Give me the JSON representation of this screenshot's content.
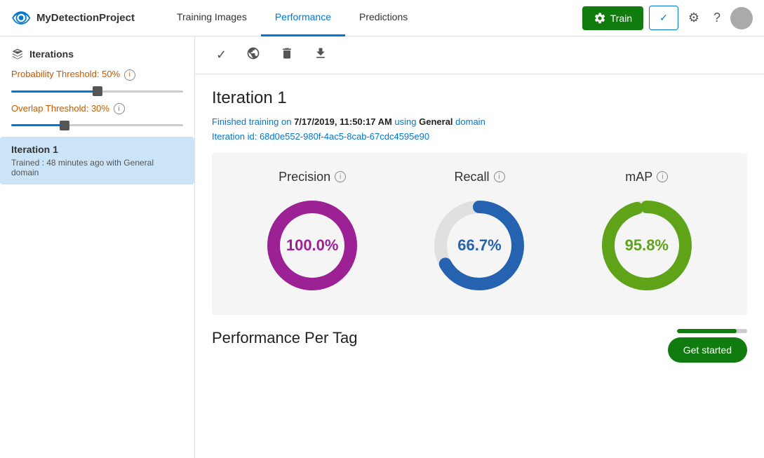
{
  "app": {
    "title": "MyDetectionProject",
    "logo_icon": "👁"
  },
  "nav": {
    "tabs": [
      {
        "id": "training-images",
        "label": "Training Images",
        "active": false
      },
      {
        "id": "performance",
        "label": "Performance",
        "active": true
      },
      {
        "id": "predictions",
        "label": "Predictions",
        "active": false
      }
    ]
  },
  "header_actions": {
    "train_label": "Train",
    "check_icon": "✓",
    "settings_icon": "⚙",
    "help_icon": "?"
  },
  "sidebar": {
    "title": "Iterations",
    "probability_threshold_label": "Probability Threshold:",
    "probability_threshold_value": "50%",
    "overlap_threshold_label": "Overlap Threshold:",
    "overlap_threshold_value": "30%",
    "iterations": [
      {
        "id": "iteration-1",
        "title": "Iteration 1",
        "description": "Trained : 48 minutes ago with General domain",
        "active": true
      }
    ]
  },
  "toolbar": {
    "check_title": "Set as Default",
    "globe_title": "Publish",
    "delete_title": "Delete",
    "download_title": "Export"
  },
  "iteration_detail": {
    "title": "Iteration 1",
    "training_date": "7/17/2019, 11:50:17 AM",
    "domain": "General",
    "iteration_id": "68d0e552-980f-4ac5-8cab-67cdc4595e90",
    "meta_line1_prefix": "Finished training on ",
    "meta_line1_suffix": " using ",
    "meta_line1_suffix2": " domain",
    "meta_line2_prefix": "Iteration id: "
  },
  "metrics": {
    "precision": {
      "label": "Precision",
      "value": "100.0%",
      "color": "#9b2195",
      "percent": 100
    },
    "recall": {
      "label": "Recall",
      "value": "66.7%",
      "color": "#2563b0",
      "percent": 66.7
    },
    "map": {
      "label": "mAP",
      "value": "95.8%",
      "color": "#5ea318",
      "percent": 95.8
    }
  },
  "performance_per_tag": {
    "title": "Performance Per Tag"
  },
  "get_started": {
    "label": "Get started"
  }
}
